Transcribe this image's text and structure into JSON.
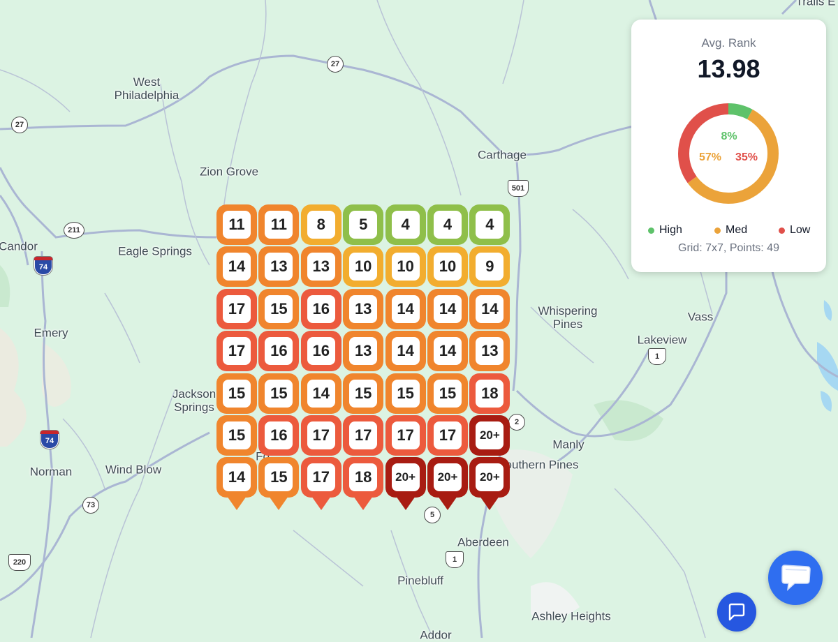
{
  "map": {
    "places": [
      {
        "name": "West\nPhiladelphia",
        "key": "west-philadelphia"
      },
      {
        "name": "Carthage",
        "key": "carthage"
      },
      {
        "name": "Zion Grove",
        "key": "zion-grove"
      },
      {
        "name": "Candor",
        "key": "candor"
      },
      {
        "name": "Eagle Springs",
        "key": "eagle-springs"
      },
      {
        "name": "Emery",
        "key": "emery"
      },
      {
        "name": "Whispering\nPines",
        "key": "whispering-pines"
      },
      {
        "name": "Vass",
        "key": "vass"
      },
      {
        "name": "Lakeview",
        "key": "lakeview"
      },
      {
        "name": "Jackson\nSprings",
        "key": "jackson-springs"
      },
      {
        "name": "Manly",
        "key": "manly"
      },
      {
        "name": "outhern Pines",
        "key": "southern-pines"
      },
      {
        "name": "Norman",
        "key": "norman"
      },
      {
        "name": "Wind Blow",
        "key": "wind-blow"
      },
      {
        "name": "Aberdeen",
        "key": "aberdeen"
      },
      {
        "name": "Pinebluff",
        "key": "pinebluff"
      },
      {
        "name": "Ashley Heights",
        "key": "ashley-heights"
      },
      {
        "name": "Addor",
        "key": "addor"
      },
      {
        "name": "Trails E",
        "key": "trails"
      },
      {
        "name": "Fo",
        "key": "fo"
      }
    ],
    "shields": [
      {
        "label": "27",
        "type": "state"
      },
      {
        "label": "27",
        "type": "state"
      },
      {
        "label": "211",
        "type": "state"
      },
      {
        "label": "74",
        "type": "interstate"
      },
      {
        "label": "74",
        "type": "interstate"
      },
      {
        "label": "501",
        "type": "us"
      },
      {
        "label": "1",
        "type": "us"
      },
      {
        "label": "2",
        "type": "state"
      },
      {
        "label": "73",
        "type": "state"
      },
      {
        "label": "5",
        "type": "state"
      },
      {
        "label": "1",
        "type": "us"
      },
      {
        "label": "220",
        "type": "us"
      }
    ]
  },
  "grid": {
    "rows": 7,
    "cols": 7,
    "ranks": [
      [
        "11",
        "11",
        "8",
        "5",
        "4",
        "4",
        "4"
      ],
      [
        "14",
        "13",
        "13",
        "10",
        "10",
        "10",
        "9"
      ],
      [
        "17",
        "15",
        "16",
        "13",
        "14",
        "14",
        "14"
      ],
      [
        "17",
        "16",
        "16",
        "13",
        "14",
        "14",
        "13"
      ],
      [
        "15",
        "15",
        "14",
        "15",
        "15",
        "15",
        "18"
      ],
      [
        "15",
        "16",
        "17",
        "17",
        "17",
        "17",
        "20+"
      ],
      [
        "14",
        "15",
        "17",
        "18",
        "20+",
        "20+",
        "20+"
      ]
    ],
    "colors": {
      "green": "#8fbf4a",
      "yellow": "#f2ad2f",
      "orange": "#f0852d",
      "red": "#ec5a3d",
      "darkred": "#a81c12"
    }
  },
  "stats": {
    "avg_label": "Avg. Rank",
    "avg_value": "13.98",
    "segments": [
      {
        "name": "High",
        "percent": 8,
        "label": "8%",
        "color": "#5ec26a"
      },
      {
        "name": "Med",
        "percent": 57,
        "label": "57%",
        "color": "#eba33a"
      },
      {
        "name": "Low",
        "percent": 35,
        "label": "35%",
        "color": "#e0504a"
      }
    ],
    "grid_info": "Grid: 7x7, Points: 49"
  },
  "chat": {
    "big_icon": "chat-bubble-icon",
    "small_icon": "message-square-icon"
  }
}
